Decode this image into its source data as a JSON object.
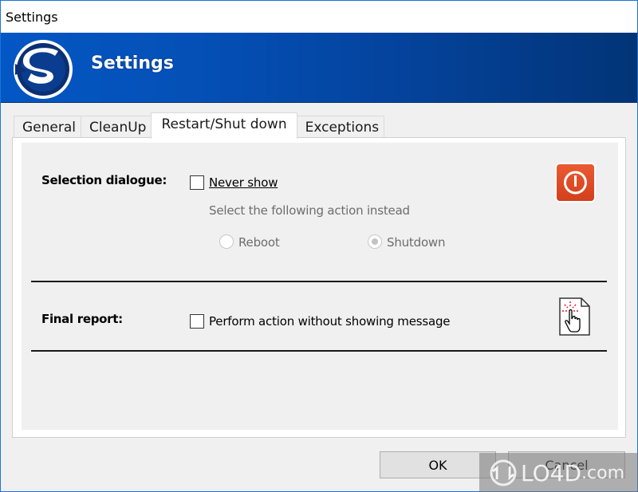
{
  "window": {
    "title": "Settings"
  },
  "banner": {
    "title": "Settings",
    "logo": "s-logo-icon"
  },
  "tabs": [
    {
      "label": "General",
      "active": false
    },
    {
      "label": "CleanUp",
      "active": false
    },
    {
      "label": "Restart/Shut down",
      "active": true
    },
    {
      "label": "Exceptions",
      "active": false
    }
  ],
  "selection_dialogue": {
    "label": "Selection dialogue:",
    "never_show": {
      "label": "Never show",
      "checked": false
    },
    "instead_text": "Select the following action instead",
    "options": [
      {
        "label": "Reboot",
        "selected": false,
        "enabled": false
      },
      {
        "label": "Shutdown",
        "selected": true,
        "enabled": false
      }
    ],
    "icon": "power-icon"
  },
  "final_report": {
    "label": "Final report:",
    "perform_action": {
      "label": "Perform action without showing message",
      "checked": false
    },
    "icon": "document-click-icon"
  },
  "buttons": {
    "ok": "OK",
    "cancel": "Cancel"
  },
  "watermark": {
    "brand": "LO4D",
    "suffix": ".com"
  }
}
